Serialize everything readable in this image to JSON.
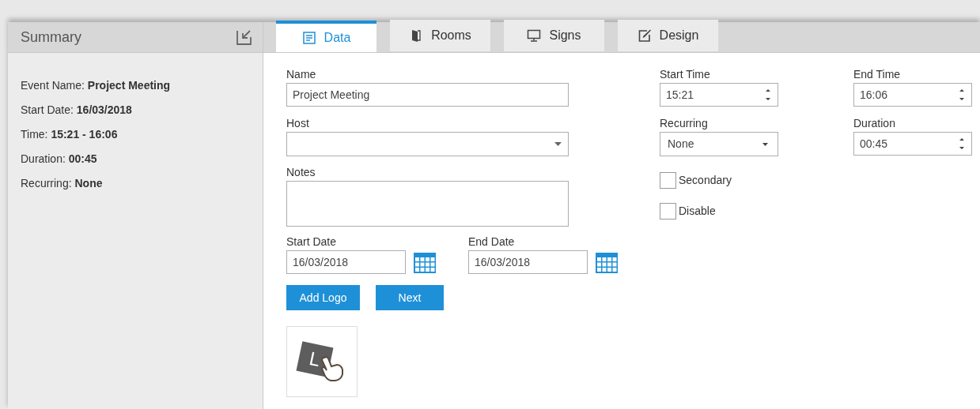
{
  "summary": {
    "title": "Summary",
    "lines": [
      "Event Name: **Project Meeting**",
      "Start Date: **16/03/2018**",
      "Time: **15:21 - 16:06**",
      "Duration: **00:45**",
      "Recurring: **None**"
    ]
  },
  "tabs": [
    {
      "label": "Data",
      "kind": "form",
      "selected": true
    },
    {
      "label": "Rooms",
      "kind": "door",
      "selected": false
    },
    {
      "label": "Signs",
      "kind": "monitor",
      "selected": false
    },
    {
      "label": "Design",
      "kind": "edit",
      "selected": false
    }
  ],
  "form": {
    "name": {
      "label": "Name",
      "value": "Project Meeting"
    },
    "host": {
      "label": "Host"
    },
    "notes": {
      "label": "Notes"
    },
    "start_date": {
      "label": "Start Date",
      "value": "16/03/2018"
    },
    "end_date": {
      "label": "End Date",
      "value": "16/03/2018"
    },
    "start_time": {
      "label": "Start Time",
      "value": "15:21"
    },
    "end_time": {
      "label": "End Time",
      "value": "16:06"
    },
    "recurring": {
      "label": "Recurring",
      "value": "None"
    },
    "duration": {
      "label": "Duration",
      "value": "00:45"
    },
    "checkboxes": [
      {
        "label": "Secondary",
        "checked": false
      },
      {
        "label": "Disable",
        "checked": false
      }
    ],
    "buttons": [
      "Add Logo",
      "Next"
    ],
    "logo_letter": "L"
  }
}
